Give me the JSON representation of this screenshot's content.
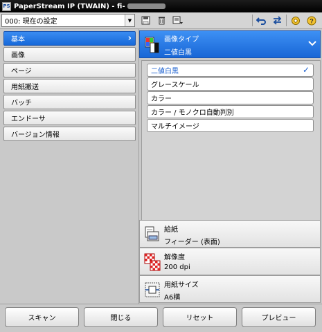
{
  "window": {
    "title": "PaperStream IP (TWAIN) - fi-",
    "app_icon": "PS"
  },
  "toolbar": {
    "profile_value": "000: 現在の設定",
    "icons": [
      "save-icon",
      "delete-icon",
      "profile-manage-icon",
      "undo-icon",
      "switch-icon",
      "settings-icon",
      "help-icon"
    ]
  },
  "nav": {
    "items": [
      {
        "label": "基本",
        "active": true
      },
      {
        "label": "画像"
      },
      {
        "label": "ページ"
      },
      {
        "label": "用紙搬送"
      },
      {
        "label": "バッチ"
      },
      {
        "label": "エンドーサ"
      },
      {
        "label": "バージョン情報"
      }
    ]
  },
  "image_type": {
    "label": "画像タイプ",
    "value": "二値白黒",
    "options": [
      {
        "label": "二値白黒",
        "selected": true
      },
      {
        "label": "グレースケール"
      },
      {
        "label": "カラー"
      },
      {
        "label": "カラー / モノクロ自動判別"
      },
      {
        "label": "マルチイメージ"
      }
    ]
  },
  "settings": {
    "paper_feed": {
      "label": "給紙",
      "value": "フィーダー (表面)"
    },
    "resolution": {
      "label": "解像度",
      "value": "200 dpi"
    },
    "paper_size": {
      "label": "用紙サイズ",
      "value": "A6横"
    }
  },
  "buttons": {
    "scan": "スキャン",
    "close": "閉じる",
    "reset": "リセット",
    "preview": "プレビュー"
  },
  "colors": {
    "accent": "#1f77e6",
    "check": "#1a5fcf",
    "titlebar": "#000000"
  }
}
